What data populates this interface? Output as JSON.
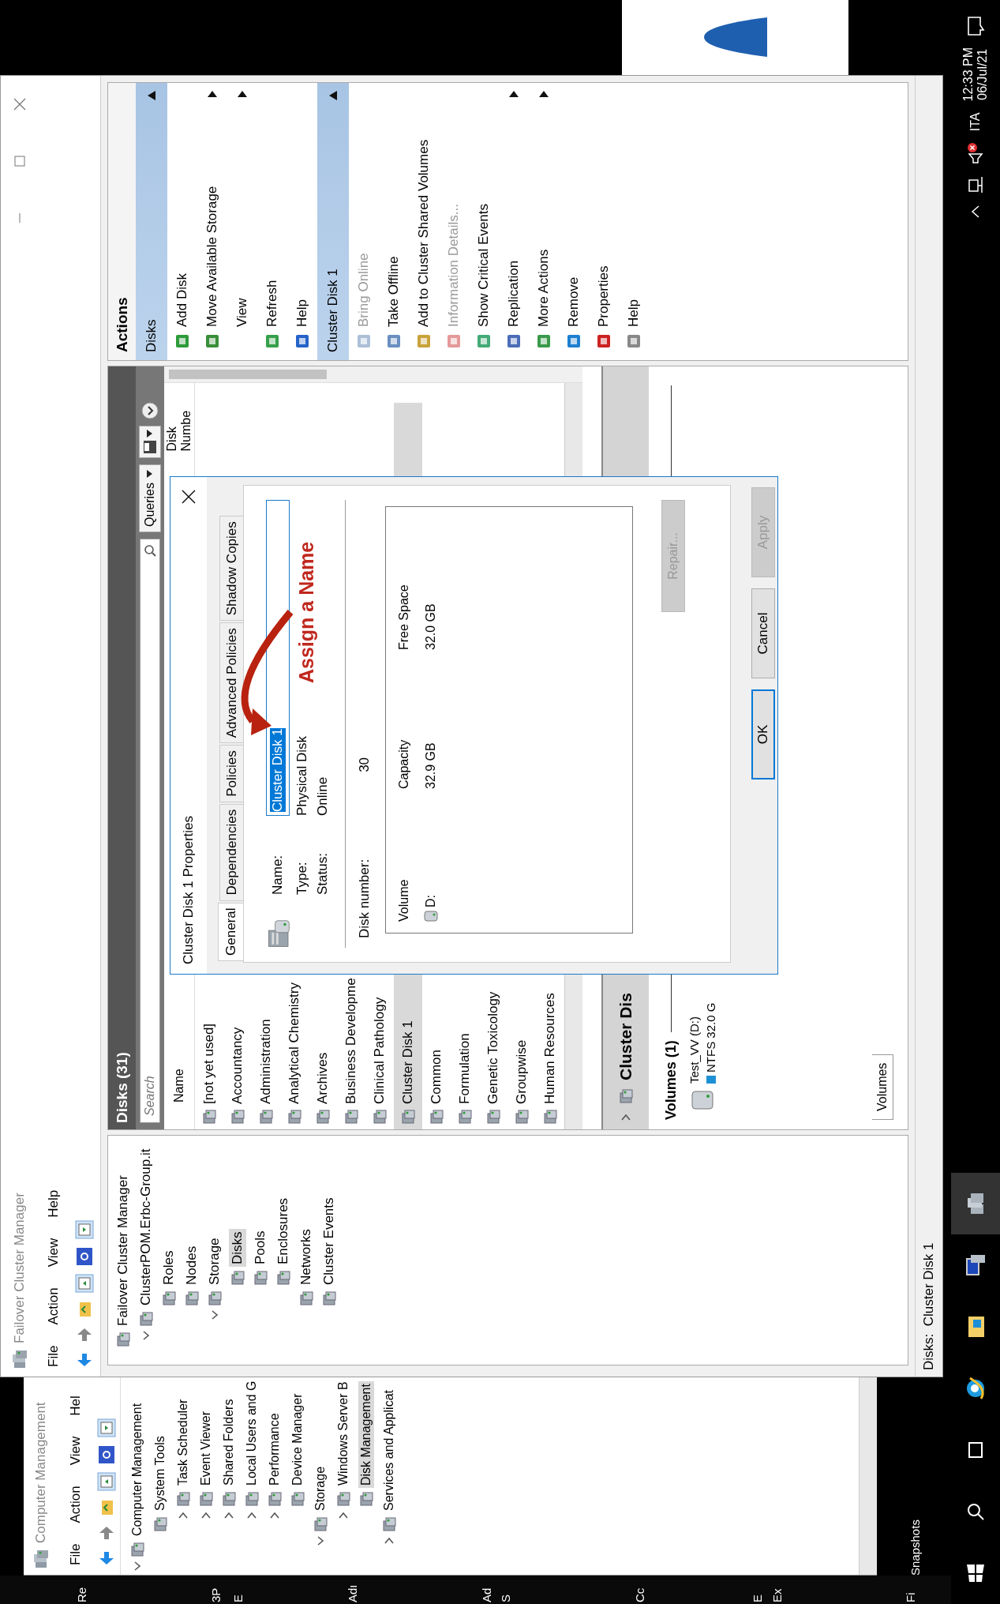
{
  "desktop": {
    "labels": [
      "Re",
      "3P",
      "E",
      "Adı",
      "Ad",
      "S",
      "Cc",
      "E",
      "Ex",
      "Fi"
    ],
    "snapshots_label": "Snapshots"
  },
  "background_window": {
    "title": "Computer Management",
    "menu": [
      "File",
      "Action",
      "View",
      "Hel"
    ],
    "tree": [
      {
        "label": "Computer Management",
        "expanded": true,
        "selected": false,
        "children": [
          {
            "label": "System Tools",
            "selected": false,
            "children": [
              {
                "label": "Task Scheduler",
                "expanded": false,
                "selected": false
              },
              {
                "label": "Event Viewer",
                "expanded": false,
                "selected": false
              },
              {
                "label": "Shared Folders",
                "expanded": false,
                "selected": false
              },
              {
                "label": "Local Users and G",
                "expanded": false,
                "selected": false
              },
              {
                "label": "Performance",
                "expanded": false,
                "selected": false
              },
              {
                "label": "Device Manager",
                "selected": false
              }
            ]
          },
          {
            "label": "Storage",
            "expanded": true,
            "selected": false,
            "children": [
              {
                "label": "Windows Server B",
                "expanded": false,
                "selected": false
              },
              {
                "label": "Disk Management",
                "selected": true
              }
            ]
          },
          {
            "label": "Services and Applicat",
            "expanded": false,
            "selected": false
          }
        ]
      }
    ]
  },
  "window": {
    "title": "Failover Cluster Manager",
    "menu": [
      "File",
      "Action",
      "View",
      "Help"
    ]
  },
  "tree": [
    {
      "label": "Failover Cluster Manager",
      "selected": false,
      "children": [
        {
          "label": "ClusterPOM.Erbc-Group.it",
          "expanded": true,
          "selected": false,
          "children": [
            {
              "label": "Roles",
              "selected": false
            },
            {
              "label": "Nodes",
              "selected": false
            },
            {
              "label": "Storage",
              "expanded": true,
              "selected": false,
              "children": [
                {
                  "label": "Disks",
                  "selected": true
                },
                {
                  "label": "Pools",
                  "selected": false
                },
                {
                  "label": "Enclosures",
                  "selected": false
                }
              ]
            },
            {
              "label": "Networks",
              "selected": false
            },
            {
              "label": "Cluster Events",
              "selected": false
            }
          ]
        }
      ]
    }
  ],
  "disks_panel": {
    "title": "Disks (31)",
    "search": {
      "placeholder": "Search"
    },
    "queries_label": "Queries",
    "columns": [
      "Name",
      "Disk Numbe"
    ],
    "rows": [
      {
        "name": "[not yet used]",
        "selected": false
      },
      {
        "name": "Accountancy",
        "selected": false
      },
      {
        "name": "Administration",
        "selected": false
      },
      {
        "name": "Analytical Chemistry",
        "selected": false
      },
      {
        "name": "Archives",
        "selected": false
      },
      {
        "name": "Business Developme",
        "selected": false
      },
      {
        "name": "Clinical Pathology",
        "selected": false
      },
      {
        "name": "Cluster Disk 1",
        "selected": true
      },
      {
        "name": "Common",
        "selected": false
      },
      {
        "name": "Formulation",
        "selected": false
      },
      {
        "name": "Genetic Toxicology",
        "selected": false
      },
      {
        "name": "Groupwise",
        "selected": false
      },
      {
        "name": "Human Resources",
        "selected": false
      }
    ],
    "details": {
      "title": "Cluster Dis",
      "volumes_title": "Volumes (1)",
      "volume_name": "Test_VV (D:)",
      "volume_info": "NTFS 32.0 G",
      "tab": "Volumes"
    }
  },
  "actions": {
    "title": "Actions",
    "groups": [
      {
        "header": "Disks",
        "items": [
          {
            "label": "Add Disk",
            "icon": true,
            "disabled": false,
            "submenu": false
          },
          {
            "label": "Move Available Storage",
            "icon": true,
            "disabled": false,
            "submenu": true
          },
          {
            "label": "View",
            "icon": false,
            "disabled": false,
            "submenu": true
          },
          {
            "label": "Refresh",
            "icon": true,
            "disabled": false,
            "submenu": false
          },
          {
            "label": "Help",
            "icon": true,
            "disabled": false,
            "submenu": false
          }
        ]
      },
      {
        "header": "Cluster Disk 1",
        "items": [
          {
            "label": "Bring Online",
            "icon": true,
            "disabled": true,
            "submenu": false
          },
          {
            "label": "Take Offline",
            "icon": true,
            "disabled": false,
            "submenu": false
          },
          {
            "label": "Add to Cluster Shared Volumes",
            "icon": true,
            "disabled": false,
            "submenu": false
          },
          {
            "label": "Information Details...",
            "icon": true,
            "disabled": true,
            "submenu": false
          },
          {
            "label": "Show Critical Events",
            "icon": true,
            "disabled": false,
            "submenu": false
          },
          {
            "label": "Replication",
            "icon": true,
            "disabled": false,
            "submenu": true
          },
          {
            "label": "More Actions",
            "icon": true,
            "disabled": false,
            "submenu": true
          },
          {
            "label": "Remove",
            "icon": true,
            "disabled": false,
            "submenu": false
          },
          {
            "label": "Properties",
            "icon": true,
            "disabled": false,
            "submenu": false
          },
          {
            "label": "Help",
            "icon": true,
            "disabled": false,
            "submenu": false
          }
        ]
      }
    ]
  },
  "dialog": {
    "title": "Cluster Disk 1 Properties",
    "tabs": [
      {
        "label": "General",
        "selected": true
      },
      {
        "label": "Dependencies",
        "selected": false
      },
      {
        "label": "Policies",
        "selected": false
      },
      {
        "label": "Advanced Policies",
        "selected": false
      },
      {
        "label": "Shadow Copies",
        "selected": false
      }
    ],
    "fields": [
      {
        "label": "Name:",
        "value": "Cluster Disk 1",
        "kind": "input",
        "text_selected": true
      },
      {
        "label": "Type:",
        "value": "Physical Disk",
        "kind": "text"
      },
      {
        "label": "Status:",
        "value": "Online",
        "kind": "text"
      }
    ],
    "disk_number_label": "Disk number:",
    "disk_number": "30",
    "table": {
      "columns": [
        "Volume",
        "Capacity",
        "Free Space"
      ],
      "rows": [
        {
          "volume": "D:",
          "capacity": "32.9 GB",
          "free": "32.0 GB"
        }
      ]
    },
    "repair_button": {
      "label": "Repair...",
      "disabled": true
    },
    "buttons": [
      {
        "label": "OK",
        "default": true,
        "disabled": false
      },
      {
        "label": "Cancel",
        "default": false,
        "disabled": false
      },
      {
        "label": "Apply",
        "default": false,
        "disabled": true
      }
    ],
    "annotation": "Assign a Name"
  },
  "status_bar": "Disks:  Cluster Disk 1",
  "taskbar": {
    "language": "ITA",
    "time": "12:33 PM",
    "date": "06/Jul/21"
  }
}
